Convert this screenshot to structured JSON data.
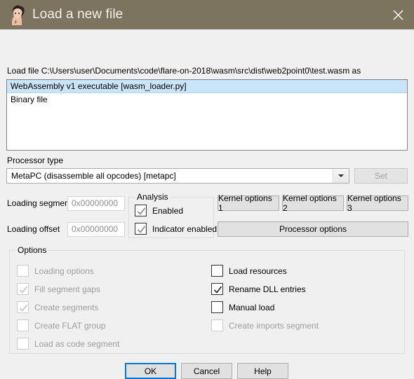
{
  "titlebar": {
    "title": "Load a new file",
    "icon": "ida-portrait-icon",
    "close_icon": "close-icon",
    "bg_color": "#7d7460",
    "text_color": "#f4f1ea"
  },
  "file_row": {
    "label": "Load file C:\\Users\\user\\Documents\\code\\flare-on-2018\\wasm\\src\\dist\\web2point0\\test.wasm as"
  },
  "loader_list": {
    "items": [
      {
        "label": "WebAssembly v1 executable [wasm_loader.py]",
        "selected": true
      },
      {
        "label": "Binary file",
        "selected": false
      }
    ],
    "selection_color": "#cce4f7"
  },
  "processor": {
    "label": "Processor type",
    "selected": "MetaPC (disassemble all opcodes) [metapc]",
    "arrow_icon": "chevron-down-icon",
    "set_label": "Set",
    "set_enabled": false
  },
  "loading": {
    "segment_label": "Loading segment",
    "segment_value": "0x00000000",
    "offset_label": "Loading offset",
    "offset_value": "0x00000000"
  },
  "analysis": {
    "group_label": "Analysis",
    "items": [
      {
        "label": "Enabled",
        "checked": true,
        "enabled": true
      },
      {
        "label": "Indicator enabled",
        "checked": true,
        "enabled": true
      }
    ]
  },
  "kernel_buttons": {
    "k1": "Kernel options 1",
    "k2": "Kernel options 2",
    "k3": "Kernel options 3",
    "processor_options": "Processor options"
  },
  "options": {
    "group_label": "Options",
    "left_column": [
      {
        "label": "Loading options",
        "checked": false,
        "enabled": false
      },
      {
        "label": "Fill segment gaps",
        "checked": true,
        "enabled": false
      },
      {
        "label": "Create segments",
        "checked": true,
        "enabled": false
      },
      {
        "label": "Create FLAT group",
        "checked": false,
        "enabled": false
      },
      {
        "label": "Load as code segment",
        "checked": false,
        "enabled": false
      }
    ],
    "right_column": [
      {
        "label": "Load resources",
        "checked": false,
        "enabled": true
      },
      {
        "label": "Rename DLL entries",
        "checked": true,
        "enabled": true
      },
      {
        "label": "Manual load",
        "checked": false,
        "enabled": true
      },
      {
        "label": "Create imports segment",
        "checked": false,
        "enabled": false
      }
    ]
  },
  "footer": {
    "ok": "OK",
    "cancel": "Cancel",
    "help": "Help",
    "default_button": "OK",
    "focus_color": "#0078d7"
  }
}
